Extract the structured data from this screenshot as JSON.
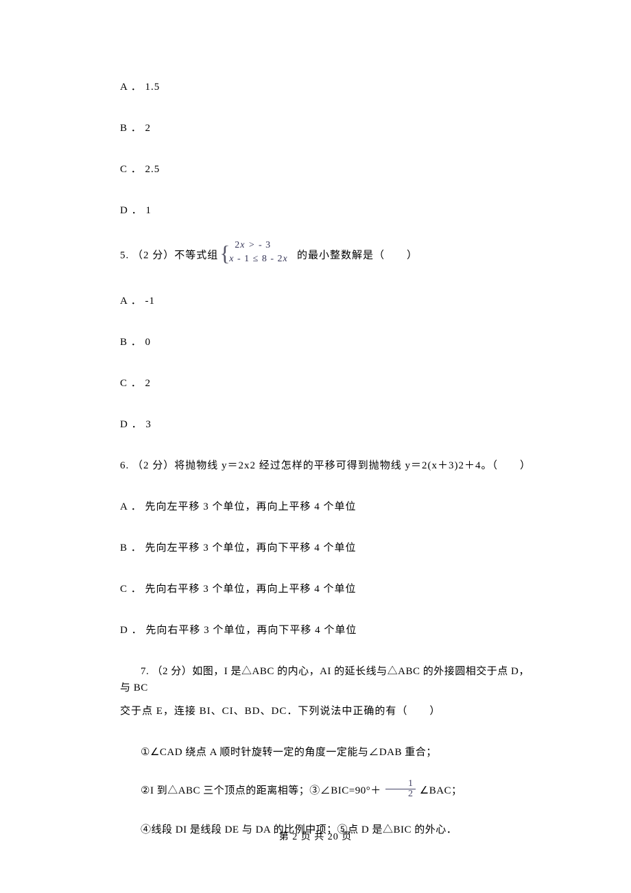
{
  "options_continued": [
    {
      "label": "A",
      "text": "1.5"
    },
    {
      "label": "B",
      "text": "2"
    },
    {
      "label": "C",
      "text": "2.5"
    },
    {
      "label": "D",
      "text": "1"
    }
  ],
  "q5": {
    "number": "5. ",
    "points": "（2 分）",
    "stem_pre": "不等式组",
    "math_top": "2x > - 3",
    "math_bot": "x - 1 ≤ 8 - 2x",
    "stem_post": " 的最小整数解是（　　）",
    "options": [
      {
        "label": "A",
        "text": "-1"
      },
      {
        "label": "B",
        "text": "0"
      },
      {
        "label": "C",
        "text": "2"
      },
      {
        "label": "D",
        "text": "3"
      }
    ]
  },
  "q6": {
    "number": "6. ",
    "points": "（2 分）",
    "stem": "将抛物线 y＝2x2 经过怎样的平移可得到抛物线 y＝2(x＋3)2＋4。（　　）",
    "options": [
      {
        "label": "A",
        "text": "先向左平移 3 个单位，再向上平移 4 个单位"
      },
      {
        "label": "B",
        "text": "先向左平移 3 个单位，再向下平移 4 个单位"
      },
      {
        "label": "C",
        "text": "先向右平移 3 个单位，再向上平移 4 个单位"
      },
      {
        "label": "D",
        "text": "先向右平移 3 个单位，再向下平移 4 个单位"
      }
    ]
  },
  "q7": {
    "number": "7. ",
    "points": "（2 分）",
    "stem_a": "如图，I 是△ABC 的内心，AI 的延长线与△ABC 的外接圆相交于点 D，与 BC",
    "stem_b": "交于点 E，连接 BI、CI、BD、DC．下列说法中正确的有（　　）",
    "statement1": "①∠CAD 绕点 A 顺时针旋转一定的角度一定能与∠DAB 重合；",
    "statement2_pre": "②I 到△ABC 三个顶点的距离相等；③∠BIC=90°＋ ",
    "frac_num": "1",
    "frac_den": "2",
    "statement2_post": " ∠BAC；",
    "statement3": "④线段 DI 是线段 DE 与 DA 的比例中项；⑤点 D 是△BIC 的外心．"
  },
  "footer": "第 2 页 共 20 页"
}
